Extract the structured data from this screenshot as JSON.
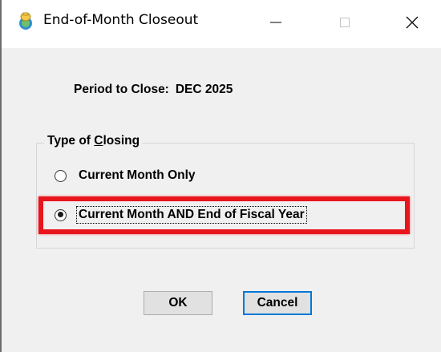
{
  "window": {
    "title": "End-of-Month Closeout"
  },
  "period": {
    "label": "Period to Close:",
    "value": "DEC 2025"
  },
  "closing_group": {
    "title_prefix": "Type of ",
    "title_underlined": "C",
    "title_suffix": "losing",
    "options": [
      {
        "label": "Current Month Only",
        "selected": false
      },
      {
        "label": "Current Month AND End of Fiscal Year",
        "selected": true
      }
    ]
  },
  "buttons": {
    "ok": "OK",
    "cancel": "Cancel"
  },
  "colors": {
    "highlight": "#e8151d",
    "default_button_border": "#0078d7",
    "dialog_background": "#f0f0f0"
  }
}
